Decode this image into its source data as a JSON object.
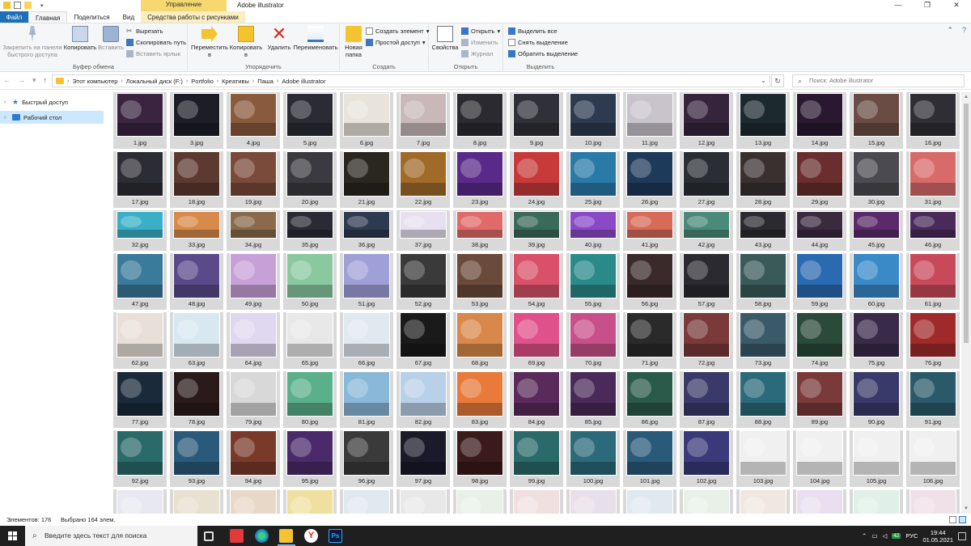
{
  "window": {
    "title": "Adobe illustrator",
    "context_tab": "Управление",
    "controls": [
      "—",
      "❐",
      "✕"
    ]
  },
  "ribbon_tabs": [
    "Файл",
    "Главная",
    "Поделиться",
    "Вид",
    "Средства работы с рисунками"
  ],
  "ribbon": {
    "clipboard": {
      "label": "Буфер обмена",
      "pin": "Закрепить на панели быстрого доступа",
      "copy": "Копировать",
      "paste": "Вставить",
      "cut": "Вырезать",
      "copy_path": "Скопировать путь",
      "paste_shortcut": "Вставить ярлык"
    },
    "organize": {
      "label": "Упорядочить",
      "move": "Переместить в",
      "copy_to": "Копировать в",
      "delete": "Удалить",
      "rename": "Переименовать"
    },
    "create": {
      "label": "Создать",
      "new_folder": "Новая папка",
      "new_item": "Создать элемент",
      "easy_access": "Простой доступ"
    },
    "open": {
      "label": "Открыть",
      "properties": "Свойства",
      "open": "Открыть",
      "edit": "Изменить",
      "history": "Журнал"
    },
    "select": {
      "label": "Выделить",
      "select_all": "Выделить все",
      "select_none": "Снять выделение",
      "invert": "Обратить выделение"
    }
  },
  "address": {
    "breadcrumbs": [
      "Этот компьютер",
      "Локальный диск (F:)",
      "Portfolio",
      "Креативы",
      "Паша",
      "Adobe illustrator"
    ],
    "search_placeholder": "Поиск: Adobe illustrator"
  },
  "nav_pane": {
    "items": [
      {
        "label": "Быстрый доступ",
        "icon": "star-icon",
        "selected": false
      },
      {
        "label": "Рабочий стол",
        "icon": "desktop-icon",
        "selected": true
      }
    ]
  },
  "files": [
    {
      "name": "1.jpg",
      "color": "#3a2440"
    },
    {
      "name": "3.jpg",
      "color": "#1d1d28"
    },
    {
      "name": "4.jpg",
      "color": "#8a5a3c"
    },
    {
      "name": "5.jpg",
      "color": "#2b2b36"
    },
    {
      "name": "6.jpg",
      "color": "#e8e4dc"
    },
    {
      "name": "7.jpg",
      "color": "#c8b8b8"
    },
    {
      "name": "8.jpg",
      "color": "#2a2a30"
    },
    {
      "name": "9.jpg",
      "color": "#303038"
    },
    {
      "name": "10.jpg",
      "color": "#2d3a50"
    },
    {
      "name": "11.jpg",
      "color": "#c9c3cc"
    },
    {
      "name": "12.jpg",
      "color": "#35243c"
    },
    {
      "name": "13.jpg",
      "color": "#1c2a30"
    },
    {
      "name": "14.jpg",
      "color": "#2a1830"
    },
    {
      "name": "15.jpg",
      "color": "#6a4c44"
    },
    {
      "name": "16.jpg",
      "color": "#2e2e34"
    },
    {
      "name": "17.jpg",
      "color": "#2c2c34"
    },
    {
      "name": "18.jpg",
      "color": "#5c3a30"
    },
    {
      "name": "19.jpg",
      "color": "#7a4a3a"
    },
    {
      "name": "20.jpg",
      "color": "#3a3a40"
    },
    {
      "name": "21.jpg",
      "color": "#2a2620"
    },
    {
      "name": "22.jpg",
      "color": "#a06a28"
    },
    {
      "name": "23.jpg",
      "color": "#5a2a8a"
    },
    {
      "name": "24.jpg",
      "color": "#c83a3a"
    },
    {
      "name": "25.jpg",
      "color": "#2a7aa8"
    },
    {
      "name": "26.jpg",
      "color": "#1e3a5a"
    },
    {
      "name": "27.jpg",
      "color": "#2a2e34"
    },
    {
      "name": "28.jpg",
      "color": "#3a3030"
    },
    {
      "name": "29.jpg",
      "color": "#6a2e2e"
    },
    {
      "name": "30.jpg",
      "color": "#4a4a50"
    },
    {
      "name": "31.jpg",
      "color": "#d86a6a"
    },
    {
      "name": "32.jpg",
      "color": "#3ab0c8"
    },
    {
      "name": "33.jpg",
      "color": "#d88a4a"
    },
    {
      "name": "34.jpg",
      "color": "#8a6a4a"
    },
    {
      "name": "35.jpg",
      "color": "#2a2a34"
    },
    {
      "name": "36.jpg",
      "color": "#2e3a50"
    },
    {
      "name": "37.jpg",
      "color": "#e8e0f0"
    },
    {
      "name": "38.jpg",
      "color": "#e06a6a"
    },
    {
      "name": "39.jpg",
      "color": "#3a6a5a"
    },
    {
      "name": "40.jpg",
      "color": "#8a4ac8"
    },
    {
      "name": "41.jpg",
      "color": "#d86a5a"
    },
    {
      "name": "42.jpg",
      "color": "#4a8a7a"
    },
    {
      "name": "43.jpg",
      "color": "#2a2a30"
    },
    {
      "name": "44.jpg",
      "color": "#3a2a40"
    },
    {
      "name": "45.jpg",
      "color": "#5a2a6a"
    },
    {
      "name": "46.jpg",
      "color": "#4a2a5a"
    },
    {
      "name": "47.jpg",
      "color": "#3a7a9a"
    },
    {
      "name": "48.jpg",
      "color": "#5a4a8a"
    },
    {
      "name": "49.jpg",
      "color": "#c8a0d8"
    },
    {
      "name": "50.jpg",
      "color": "#8ac8a0"
    },
    {
      "name": "51.jpg",
      "color": "#a0a0d8"
    },
    {
      "name": "52.jpg",
      "color": "#3a3a3a"
    },
    {
      "name": "53.jpg",
      "color": "#6a4a3a"
    },
    {
      "name": "54.jpg",
      "color": "#d8506a"
    },
    {
      "name": "55.jpg",
      "color": "#2a8a8a"
    },
    {
      "name": "56.jpg",
      "color": "#3a2a2a"
    },
    {
      "name": "57.jpg",
      "color": "#2a2a30"
    },
    {
      "name": "58.jpg",
      "color": "#3a5a5a"
    },
    {
      "name": "59.jpg",
      "color": "#2a6ab0"
    },
    {
      "name": "60.jpg",
      "color": "#3a8ac8"
    },
    {
      "name": "61.jpg",
      "color": "#c84a5a"
    },
    {
      "name": "62.jpg",
      "color": "#e8e0d8"
    },
    {
      "name": "63.jpg",
      "color": "#d8e8f0"
    },
    {
      "name": "64.jpg",
      "color": "#e0d8f0"
    },
    {
      "name": "65.jpg",
      "color": "#e8e8e8"
    },
    {
      "name": "66.jpg",
      "color": "#e0e8f0"
    },
    {
      "name": "67.jpg",
      "color": "#1a1a1a"
    },
    {
      "name": "68.jpg",
      "color": "#d8884a"
    },
    {
      "name": "69.jpg",
      "color": "#e0508a"
    },
    {
      "name": "70.jpg",
      "color": "#c8508a"
    },
    {
      "name": "71.jpg",
      "color": "#2a2a2a"
    },
    {
      "name": "72.jpg",
      "color": "#7a3a3a"
    },
    {
      "name": "73.jpg",
      "color": "#3a5a6a"
    },
    {
      "name": "74.jpg",
      "color": "#2a4a3a"
    },
    {
      "name": "75.jpg",
      "color": "#3a2a4a"
    },
    {
      "name": "76.jpg",
      "color": "#a02a2a"
    },
    {
      "name": "77.jpg",
      "color": "#1a2a3a"
    },
    {
      "name": "78.jpg",
      "color": "#2a1a1a"
    },
    {
      "name": "79.jpg",
      "color": "#d8d8d8"
    },
    {
      "name": "80.jpg",
      "color": "#5ab08a"
    },
    {
      "name": "81.jpg",
      "color": "#8ab8d8"
    },
    {
      "name": "82.jpg",
      "color": "#b8d0e8"
    },
    {
      "name": "83.jpg",
      "color": "#e87a3a"
    },
    {
      "name": "84.jpg",
      "color": "#5a2a5a"
    },
    {
      "name": "85.jpg",
      "color": "#4a2a5a"
    },
    {
      "name": "86.jpg",
      "color": "#2a5a4a"
    },
    {
      "name": "87.jpg",
      "color": "#3a3a6a"
    },
    {
      "name": "88.jpg",
      "color": "#2a6a7a"
    },
    {
      "name": "89.jpg",
      "color": "#7a3a3a"
    },
    {
      "name": "90.jpg",
      "color": "#3a3a6a"
    },
    {
      "name": "91.jpg",
      "color": "#2a5a6a"
    },
    {
      "name": "92.jpg",
      "color": "#2a6a6a"
    },
    {
      "name": "93.jpg",
      "color": "#2a5a7a"
    },
    {
      "name": "94.jpg",
      "color": "#7a3a2a"
    },
    {
      "name": "95.jpg",
      "color": "#4a2a6a"
    },
    {
      "name": "96.jpg",
      "color": "#3a3a3a"
    },
    {
      "name": "97.jpg",
      "color": "#1a1a2a"
    },
    {
      "name": "98.jpg",
      "color": "#3a1a1a"
    },
    {
      "name": "99.jpg",
      "color": "#2a6a6a"
    },
    {
      "name": "100.jpg",
      "color": "#2a6a7a"
    },
    {
      "name": "101.jpg",
      "color": "#2a5a7a"
    },
    {
      "name": "102.jpg",
      "color": "#3a3a7a"
    },
    {
      "name": "103.jpg",
      "color": "#f0f0f0"
    },
    {
      "name": "104.jpg",
      "color": "#f0f0f0"
    },
    {
      "name": "105.jpg",
      "color": "#f0f0f0"
    },
    {
      "name": "106.jpg",
      "color": "#f0f0f0"
    },
    {
      "name": "",
      "color": "#e8e8f0"
    },
    {
      "name": "",
      "color": "#e8e0d0"
    },
    {
      "name": "",
      "color": "#e8d8c8"
    },
    {
      "name": "",
      "color": "#f0e0a0"
    },
    {
      "name": "",
      "color": "#e0e8f0"
    },
    {
      "name": "",
      "color": "#e8e8e8"
    },
    {
      "name": "",
      "color": "#e8f0e8"
    },
    {
      "name": "",
      "color": "#f0e0e0"
    },
    {
      "name": "",
      "color": "#e8e0e8"
    },
    {
      "name": "",
      "color": "#e0e8f0"
    },
    {
      "name": "",
      "color": "#e8f0e8"
    },
    {
      "name": "",
      "color": "#f0e8e0"
    },
    {
      "name": "",
      "color": "#e8e0f0"
    },
    {
      "name": "",
      "color": "#e0f0e8"
    },
    {
      "name": "",
      "color": "#f0e0e8"
    }
  ],
  "status": {
    "count": "Элементов: 176",
    "selected": "Выбрано 164 элем."
  },
  "taskbar": {
    "search_placeholder": "Введите здесь текст для поиска",
    "lang": "РУС",
    "battery": "42",
    "time": "19:44",
    "date": "01.05.2021"
  },
  "colors": {
    "accent": "#1e6fb8",
    "selection": "#cce8ff",
    "tile_selected": "#d9d9d9",
    "context_tab": "#f6d96e"
  }
}
